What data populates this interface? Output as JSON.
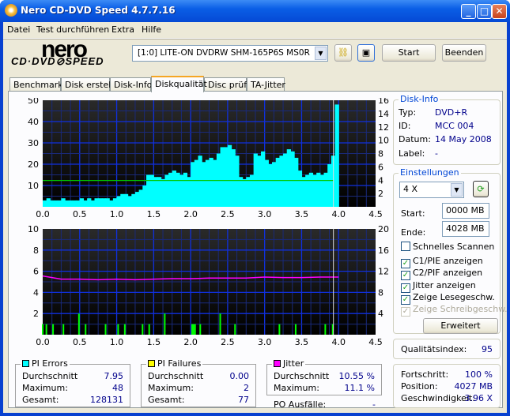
{
  "window": {
    "title": "Nero CD-DVD Speed 4.7.7.16"
  },
  "menu": [
    "Datei",
    "Test durchführen",
    "Extra",
    "Hilfe"
  ],
  "logo": {
    "line1": "nero",
    "line2": "CD·DVD⊘SPEED"
  },
  "toolbar": {
    "drive": "[1:0]   LITE-ON DVDRW SHM-165P6S MS0R",
    "start": "Start",
    "quit": "Beenden"
  },
  "tabs": [
    "Benchmark",
    "Disk erstellen",
    "Disk-Info",
    "Diskqualität",
    "Disc prüfen",
    "TA-Jitter"
  ],
  "active_tab": "Diskqualität",
  "disk_info": {
    "title": "Disk-Info",
    "rows": [
      {
        "k": "Typ:",
        "v": "DVD+R"
      },
      {
        "k": "ID:",
        "v": "MCC 004"
      },
      {
        "k": "Datum:",
        "v": "14 May 2008"
      },
      {
        "k": "Label:",
        "v": "-"
      }
    ]
  },
  "settings": {
    "title": "Einstellungen",
    "speed": "4 X",
    "start_label": "Start:",
    "start": "0000 MB",
    "end_label": "Ende:",
    "end": "4028 MB",
    "checks": [
      {
        "label": "Schnelles Scannen",
        "checked": false,
        "enabled": true
      },
      {
        "label": "C1/PIE anzeigen",
        "checked": true,
        "enabled": true
      },
      {
        "label": "C2/PIF anzeigen",
        "checked": true,
        "enabled": true
      },
      {
        "label": "Jitter anzeigen",
        "checked": true,
        "enabled": true
      },
      {
        "label": "Zeige Lesegeschw.",
        "checked": true,
        "enabled": true
      },
      {
        "label": "Zeige Schreibgeschw.",
        "checked": true,
        "enabled": false
      }
    ],
    "advanced": "Erweitert"
  },
  "quality": {
    "label": "Qualitätsindex:",
    "value": "95"
  },
  "progress": {
    "rows": [
      {
        "k": "Fortschritt:",
        "v": "100 %"
      },
      {
        "k": "Position:",
        "v": "4027 MB"
      },
      {
        "k": "Geschwindigkeit:",
        "v": "3.96 X"
      }
    ]
  },
  "pi_errors": {
    "title": "PI Errors",
    "color": "#00ffff",
    "rows": [
      {
        "k": "Durchschnitt",
        "v": "7.95"
      },
      {
        "k": "Maximum:",
        "v": "48"
      },
      {
        "k": "Gesamt:",
        "v": "128131"
      }
    ]
  },
  "pi_failures": {
    "title": "PI Failures",
    "color": "#ffff00",
    "rows": [
      {
        "k": "Durchschnitt",
        "v": "0.00"
      },
      {
        "k": "Maximum:",
        "v": "2"
      },
      {
        "k": "Gesamt:",
        "v": "77"
      }
    ]
  },
  "jitter": {
    "title": "Jitter",
    "color": "#ff00ff",
    "rows": [
      {
        "k": "Durchschnitt",
        "v": "10.55 %"
      },
      {
        "k": "Maximum:",
        "v": "11.1 %"
      }
    ]
  },
  "po": {
    "label": "PO Ausfälle:",
    "value": "-"
  },
  "chart_data": [
    {
      "type": "area",
      "xlim": [
        0,
        4.5
      ],
      "ylim": [
        0,
        50
      ],
      "y2lim": [
        0,
        16
      ],
      "xticks": [
        "0.0",
        "0.5",
        "1.0",
        "1.5",
        "2.0",
        "2.5",
        "3.0",
        "3.5",
        "4.0",
        "4.5"
      ],
      "yticks": [
        "10",
        "20",
        "30",
        "40",
        "50"
      ],
      "y2ticks": [
        "2",
        "4",
        "6",
        "8",
        "10",
        "12",
        "14",
        "16"
      ],
      "series": [
        {
          "key": "pie",
          "color": "#00ffff",
          "x_start": 0,
          "x_step": 0.05,
          "values": [
            3,
            4,
            3,
            3,
            3,
            4,
            3,
            3,
            3,
            3,
            4,
            3,
            4,
            3,
            4,
            4,
            4,
            4,
            3,
            4,
            5,
            6,
            6,
            5,
            6,
            7,
            8,
            10,
            15,
            15,
            14,
            14,
            13,
            15,
            16,
            17,
            16,
            15,
            16,
            14,
            21,
            22,
            24,
            21,
            22,
            23,
            22,
            25,
            28,
            28,
            29,
            27,
            24,
            14,
            13,
            14,
            15,
            25,
            24,
            26,
            22,
            20,
            21,
            23,
            24,
            25,
            27,
            26,
            23,
            17,
            14,
            15,
            16,
            15,
            16,
            15,
            16,
            20,
            24,
            48
          ]
        },
        {
          "key": "read_speed",
          "color": "#00c800",
          "axis": "right",
          "x": [
            0,
            3.93
          ],
          "values": [
            3.96,
            3.96
          ]
        }
      ],
      "end_marker": 3.93
    },
    {
      "type": "bar",
      "xlim": [
        0,
        4.5
      ],
      "ylim": [
        0,
        10
      ],
      "y2lim": [
        0,
        20
      ],
      "xticks": [
        "0.0",
        "0.5",
        "1.0",
        "1.5",
        "2.0",
        "2.5",
        "3.0",
        "3.5",
        "4.0",
        "4.5"
      ],
      "yticks": [
        "2",
        "4",
        "6",
        "8",
        "10"
      ],
      "y2ticks": [
        "4",
        "8",
        "12",
        "16",
        "20"
      ],
      "series": [
        {
          "key": "pif",
          "color": "#00ff00",
          "x": [
            0.0,
            0.05,
            0.14,
            0.28,
            0.49,
            0.58,
            0.85,
            1.02,
            1.11,
            1.35,
            1.44,
            1.65,
            2.02,
            2.04,
            2.06,
            2.13,
            2.4,
            2.6,
            3.2,
            3.42,
            3.82,
            3.92
          ],
          "values": [
            1,
            1,
            1,
            1,
            2,
            1,
            1,
            1,
            1,
            1,
            1,
            2,
            1,
            1,
            1,
            1,
            2,
            1,
            1,
            1,
            1,
            1
          ]
        },
        {
          "key": "jitter",
          "color": "#ff00ff",
          "axis": "right",
          "x_start": 0,
          "x_step": 0.25,
          "values": [
            11.1,
            10.5,
            10.5,
            10.4,
            10.5,
            10.4,
            10.5,
            10.6,
            10.6,
            10.7,
            10.7,
            10.7,
            10.9,
            10.8,
            10.8,
            10.9,
            10.9
          ]
        }
      ],
      "end_marker": 3.93
    }
  ]
}
